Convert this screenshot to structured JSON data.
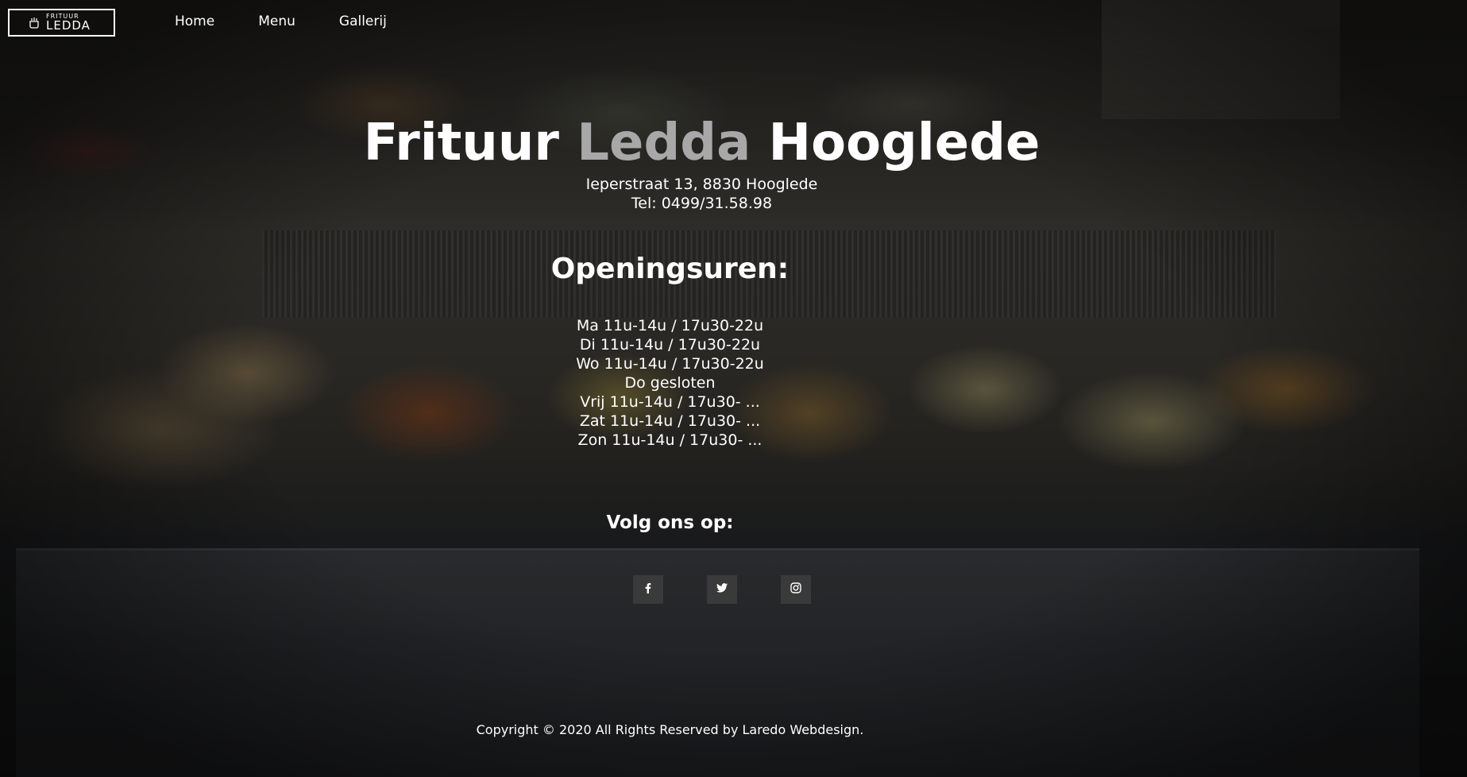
{
  "logo": {
    "top_text": "FRITUUR",
    "bottom_text": "LEDDA",
    "icon": "fryer-basket-icon"
  },
  "nav": {
    "items": [
      {
        "label": "Home"
      },
      {
        "label": "Menu"
      },
      {
        "label": "Gallerij"
      }
    ]
  },
  "hero": {
    "title_part1": "Frituur ",
    "title_accent": "Ledda",
    "title_part2": " Hooglede",
    "address": "Ieperstraat 13, 8830 Hooglede",
    "phone": "Tel: 0499/31.58.98"
  },
  "hours": {
    "title": "Openingsuren:",
    "lines": [
      "Ma 11u-14u / 17u30-22u",
      "Di 11u-14u / 17u30-22u",
      "Wo 11u-14u / 17u30-22u",
      "Do gesloten",
      "Vrij 11u-14u / 17u30- ...",
      "Zat 11u-14u / 17u30- ...",
      "Zon 11u-14u / 17u30- ..."
    ]
  },
  "social": {
    "title": "Volg ons op:",
    "items": [
      {
        "icon": "facebook-icon",
        "glyph": "f"
      },
      {
        "icon": "twitter-icon",
        "glyph": "t"
      },
      {
        "icon": "instagram-icon",
        "glyph": "ig"
      }
    ]
  },
  "footer": {
    "copyright": "Copyright © 2020 All Rights Reserved by Laredo Webdesign."
  },
  "colors": {
    "text": "#ffffff",
    "accent": "#a8a8a8",
    "social_bg": "#3a3a3a"
  }
}
